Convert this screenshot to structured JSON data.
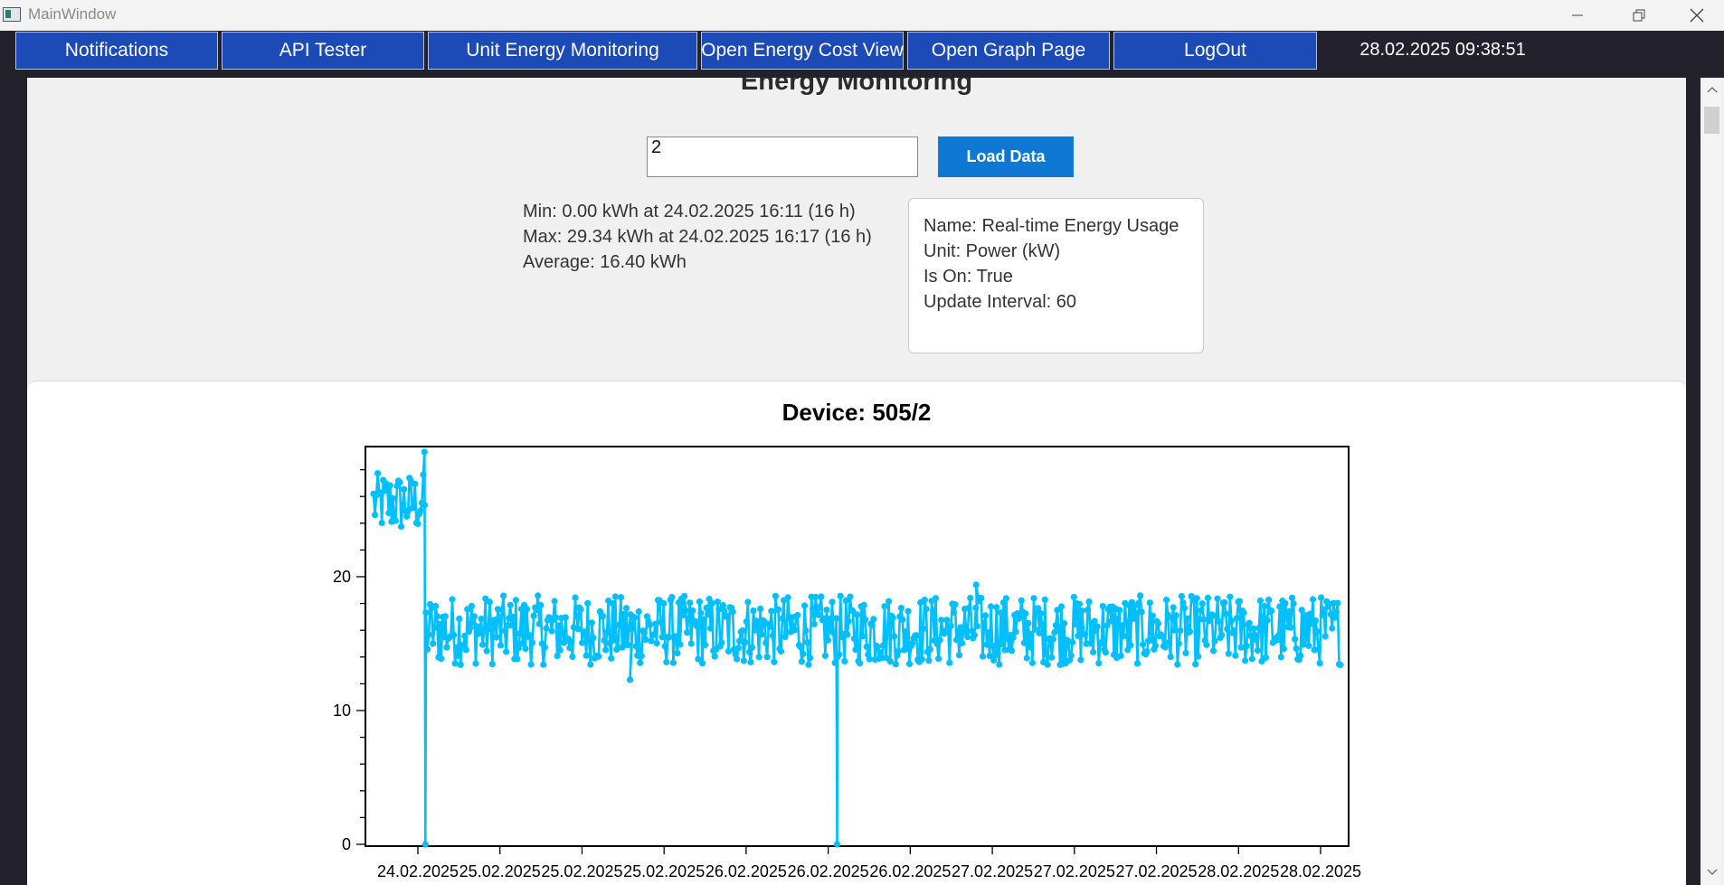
{
  "window": {
    "title": "MainWindow",
    "controls": [
      "minimize-icon",
      "restore-icon",
      "close-icon"
    ]
  },
  "toolbar": {
    "buttons": [
      {
        "label": "Notifications"
      },
      {
        "label": "API Tester"
      },
      {
        "label": "Unit Energy Monitoring"
      },
      {
        "label": "Open Energy Cost View"
      },
      {
        "label": "Open Graph Page"
      },
      {
        "label": "LogOut"
      }
    ],
    "datetime": "28.02.2025 09:38:51"
  },
  "page": {
    "heading": "Energy Monitoring",
    "input_value": "2",
    "load_button": "Load Data"
  },
  "stats": {
    "min": "Min: 0.00 kWh at 24.02.2025 16:11 (16 h)",
    "max": "Max: 29.34 kWh at 24.02.2025 16:17 (16 h)",
    "average": "Average: 16.40 kWh"
  },
  "device_info": {
    "name": "Name: Real-time Energy Usage",
    "unit": "Unit: Power (kW)",
    "is_on": "Is On: True",
    "update_interval": "Update Interval: 60"
  },
  "colors": {
    "nav_button": "#1c4ab6",
    "load_button": "#0f78d2",
    "series": "#00bfff",
    "background_dark": "#22212c"
  },
  "chart_data": {
    "type": "line",
    "title": "Device: 505/2",
    "xlabel": "",
    "ylabel": "",
    "ylim": [
      0,
      30
    ],
    "yticks": [
      0,
      10,
      20
    ],
    "grid": false,
    "xticks": [
      "24.02.2025",
      "25.02.2025",
      "25.02.2025",
      "25.02.2025",
      "26.02.2025",
      "26.02.2025",
      "26.02.2025",
      "27.02.2025",
      "27.02.2025",
      "27.02.2025",
      "28.02.2025",
      "28.02.2025"
    ],
    "series": [
      {
        "color": "#00bfff",
        "start_level": {
          "x_range_days": [
            0,
            0.6
          ],
          "mean": 25.5,
          "min": 22.6,
          "max": 29.34
        },
        "drops_to_zero_at_x_days": [
          0.6,
          5.37
        ],
        "steady_level": {
          "mean": 16.0,
          "min": 12.3,
          "max": 19.4
        },
        "x_range_days": [
          0,
          11.2
        ]
      }
    ]
  }
}
